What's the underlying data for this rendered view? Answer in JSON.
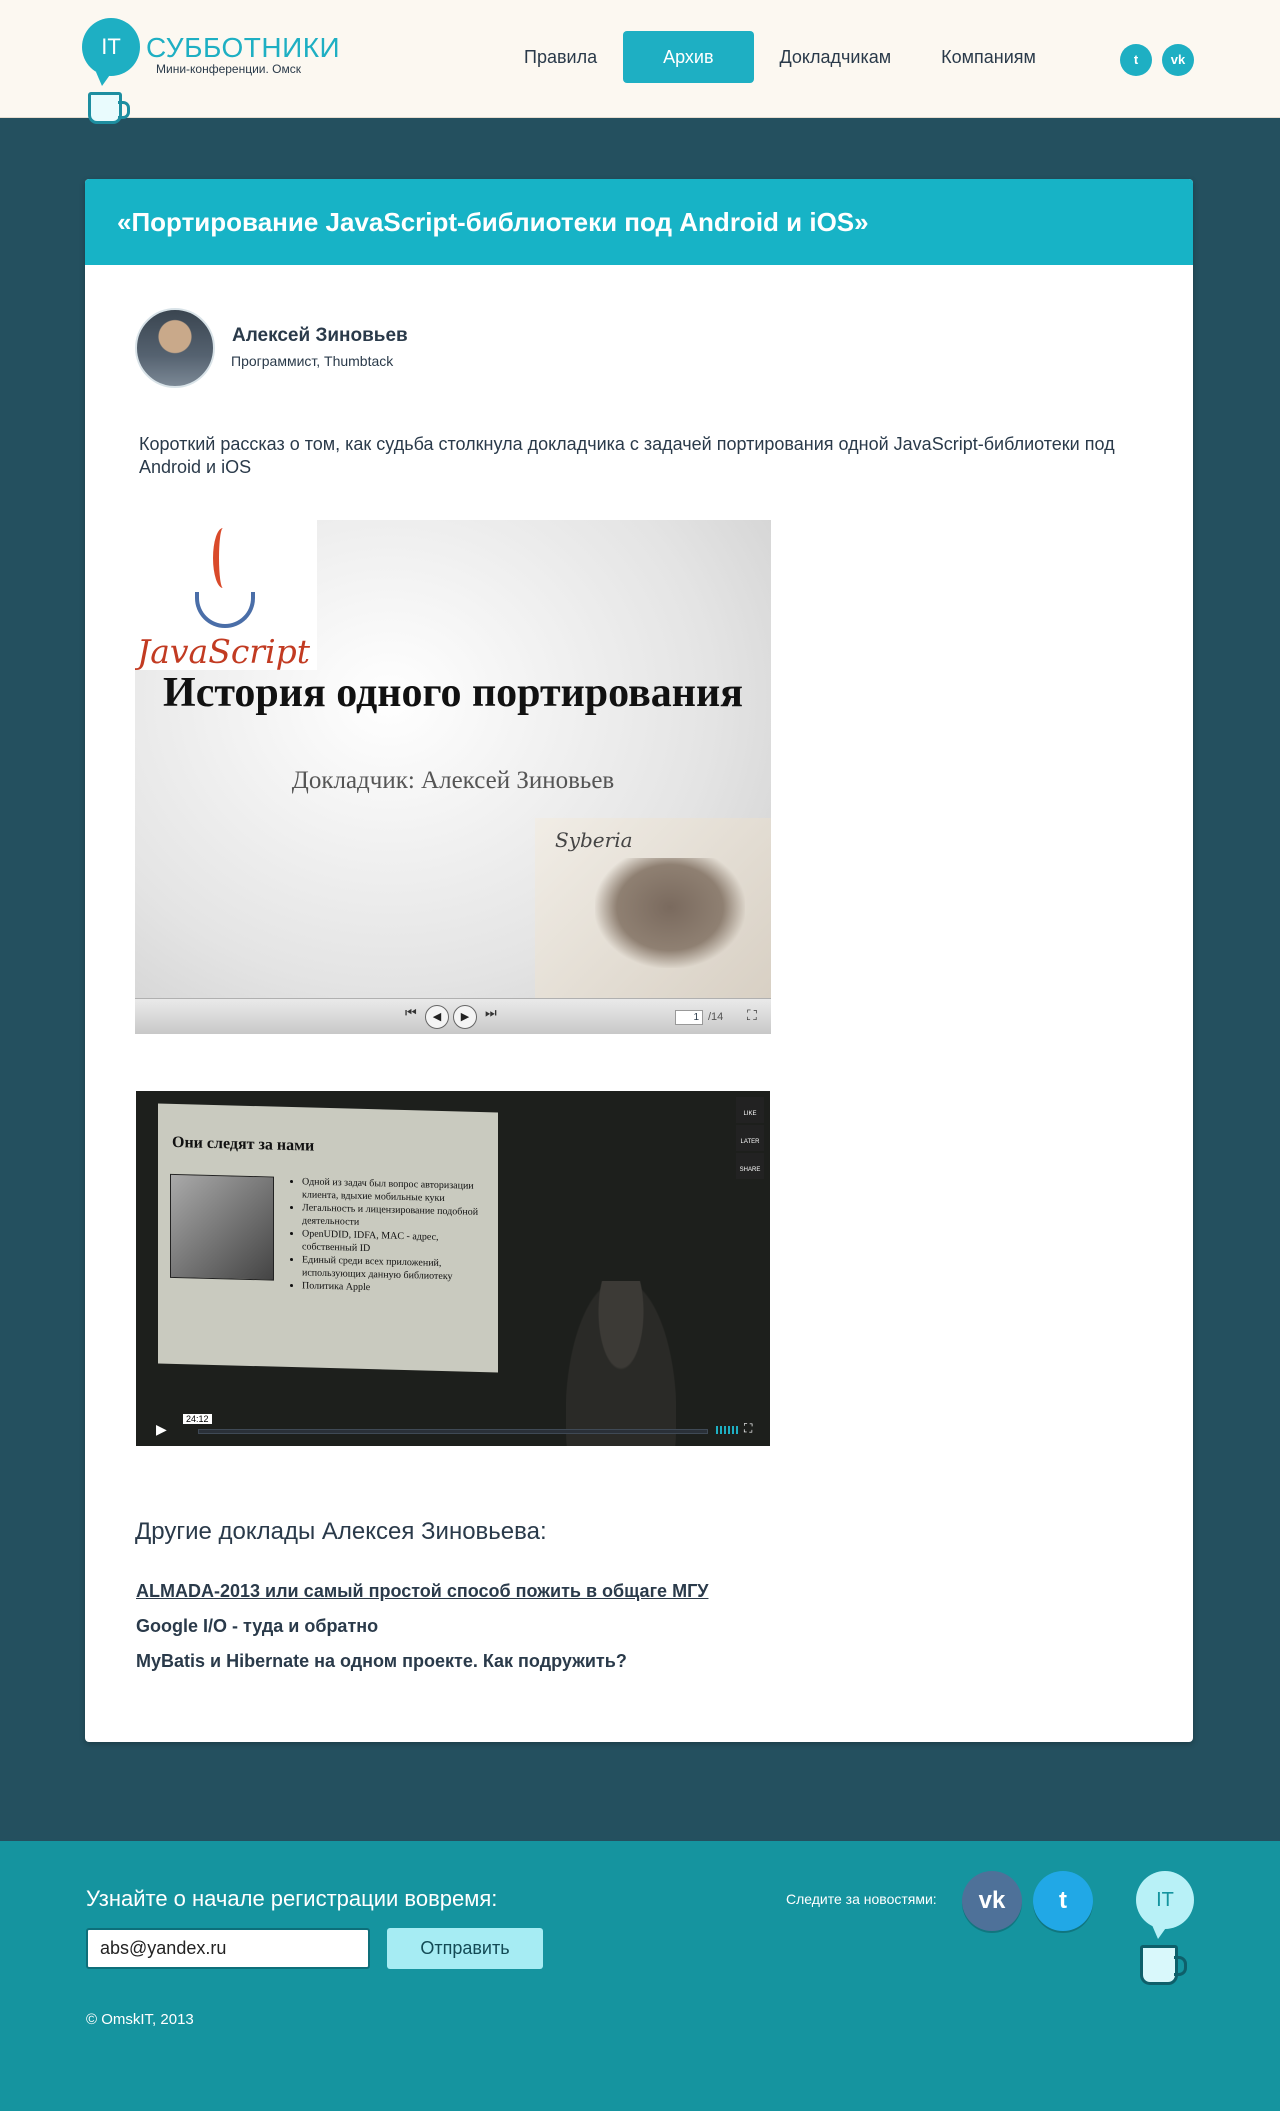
{
  "header": {
    "logo_badge": "IT",
    "logo_title": "СУББОТНИКИ",
    "logo_subtitle": "Мини-конференции. Омск",
    "nav": [
      {
        "label": "Правила"
      },
      {
        "label": "Архив",
        "active": true
      },
      {
        "label": "Докладчикам"
      },
      {
        "label": "Компаниям"
      }
    ],
    "social": [
      {
        "icon": "twitter-icon",
        "glyph": "t"
      },
      {
        "icon": "vk-icon",
        "glyph": "vk"
      }
    ]
  },
  "talk": {
    "title": "«Портирование JavaScript-библиотеки под Android и iOS»",
    "author_name": "Алексей Зиновьев",
    "author_role": "Программист, Thumbtack",
    "description": "Короткий рассказ о том, как судьба столкнула докладчика с задачей портирования одной JavaScript-библиотеки под Android и iOS"
  },
  "slides": {
    "logo_text": "JavaScript",
    "title": "История одного портирования",
    "speaker": "Докладчик: Алексей Зиновьев",
    "brand": "Syberia",
    "current_page": "1",
    "total_pages": "/14"
  },
  "video": {
    "slide_title": "Они следят за нами",
    "bullets": [
      "Одной из задач был вопрос авторизации клиента, вдыхие мобильные куки",
      "Легальность и лицензирование подобной деятельности",
      "OpenUDID, IDFA, MAC - адрес, собственный ID",
      "Единый среди всех приложений, использующих данную библиотеку",
      "Политика Apple"
    ],
    "side_buttons": [
      "LIKE",
      "LATER",
      "SHARE"
    ],
    "time": "24:12"
  },
  "other_talks": {
    "heading": "Другие доклады Алексея Зиновьева:",
    "items": [
      "ALMADA-2013 или самый простой способ пожить в общаге МГУ",
      "Google I/O - туда и обратно",
      "MyBatis и Hibernate на одном проекте. Как подружить?"
    ]
  },
  "footer": {
    "subscribe_title": "Узнайте о начале регистрации вовремя:",
    "email_value": "abs@yandex.ru",
    "submit_label": "Отправить",
    "follow_label": "Следите за новостями:",
    "copyright": "©  OmskIT, 2013",
    "logo_badge": "IT",
    "social": [
      {
        "icon": "vk-icon",
        "glyph": "vk"
      },
      {
        "icon": "twitter-icon",
        "glyph": "t"
      }
    ]
  },
  "colors": {
    "accent": "#1eafc3",
    "page_background": "#24505f",
    "footer_background": "#15949f",
    "header_background": "#fcf8f1"
  }
}
